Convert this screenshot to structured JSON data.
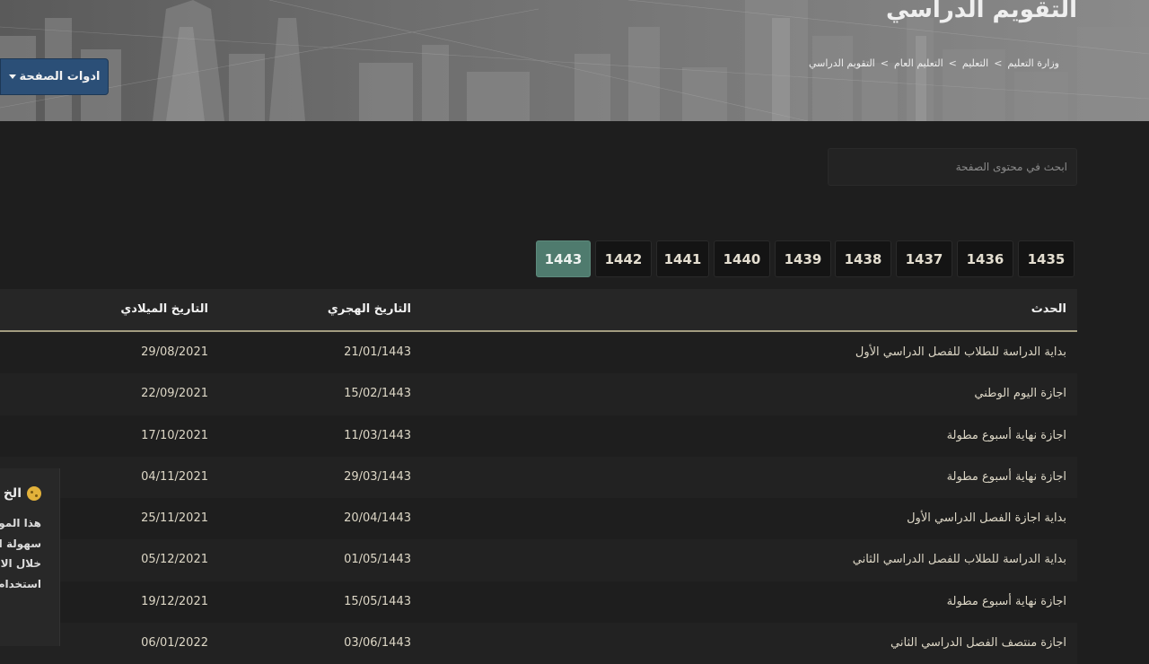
{
  "header": {
    "title": "التقويم الدراسي",
    "breadcrumb": [
      "وزارة التعليم",
      "التعليم",
      "التعليم العام",
      "التقويم الدراسي"
    ],
    "breadcrumb_separator": ">",
    "tools_button": "ادوات الصفحة"
  },
  "search": {
    "placeholder": "ابحث في محتوى الصفحة"
  },
  "years": {
    "items": [
      "1435",
      "1436",
      "1437",
      "1438",
      "1439",
      "1440",
      "1441",
      "1442",
      "1443"
    ],
    "active": "1443"
  },
  "table": {
    "headers": {
      "event": "الحدث",
      "hijri": "التاريخ الهجري",
      "gregorian": "التاريخ الميلادي"
    },
    "rows": [
      {
        "event": "بداية الدراسة للطلاب للفصل الدراسي الأول",
        "hijri": "21/01/1443",
        "gregorian": "29/08/2021"
      },
      {
        "event": "اجازة اليوم الوطني",
        "hijri": "15/02/1443",
        "gregorian": "22/09/2021"
      },
      {
        "event": "اجازة نهاية أسبوع مطولة",
        "hijri": "11/03/1443",
        "gregorian": "17/10/2021"
      },
      {
        "event": "اجازة نهاية أسبوع مطولة",
        "hijri": "29/03/1443",
        "gregorian": "04/11/2021"
      },
      {
        "event": "بداية اجازة الفصل الدراسي الأول",
        "hijri": "20/04/1443",
        "gregorian": "25/11/2021"
      },
      {
        "event": "بداية الدراسة للطلاب للفصل الدراسي الثاني",
        "hijri": "01/05/1443",
        "gregorian": "05/12/2021"
      },
      {
        "event": "اجازة نهاية أسبوع مطولة",
        "hijri": "15/05/1443",
        "gregorian": "19/12/2021"
      },
      {
        "event": "اجازة منتصف الفصل الدراسي الثاني",
        "hijri": "03/06/1443",
        "gregorian": "06/01/2022"
      }
    ]
  },
  "cookie_panel": {
    "title": "الخ",
    "lines": [
      "هذا المو",
      "سهولة ا",
      "خلال الا",
      "استخدام"
    ],
    "icon": "cookie-icon"
  },
  "colors": {
    "background": "#1e1e1e",
    "active_year": "#4f7b6e",
    "tools_button": "#2b4f77",
    "header_rule": "#a39c80"
  }
}
